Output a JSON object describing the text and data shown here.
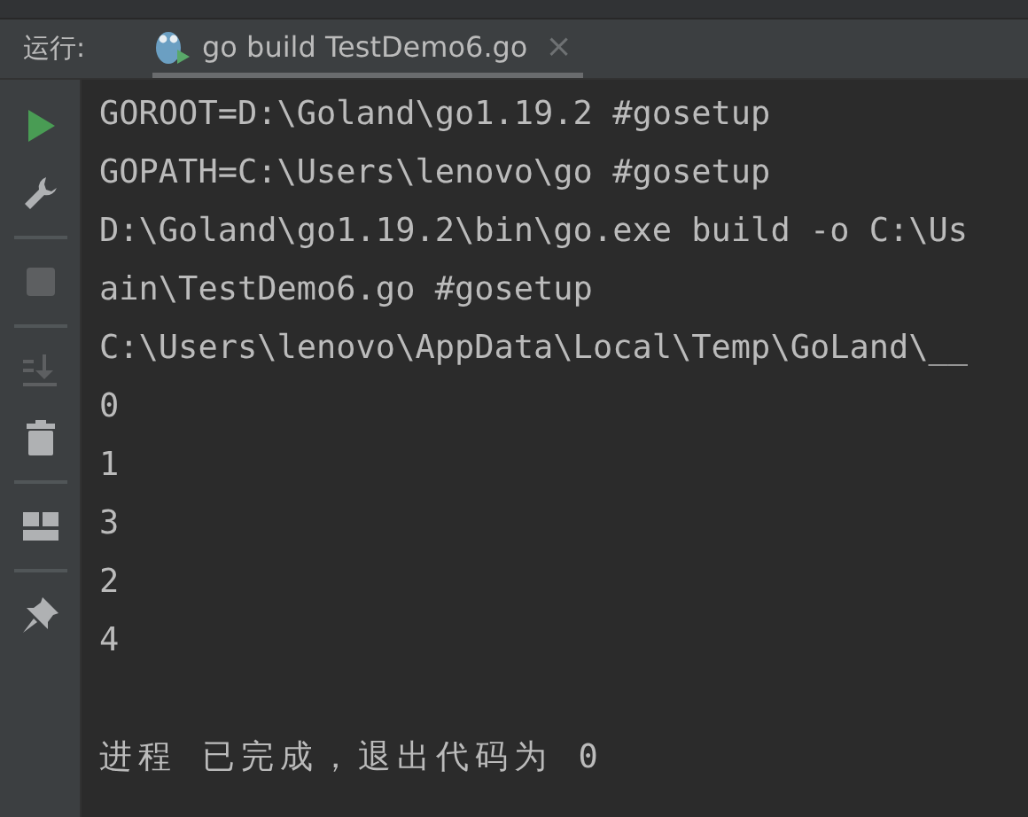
{
  "run_bar": {
    "label": "运行:",
    "tab": {
      "title": "go build TestDemo6.go",
      "close": "×",
      "selected": true
    }
  },
  "toolbar": [
    {
      "kind": "run",
      "disabled": false
    },
    {
      "kind": "settings",
      "disabled": false
    },
    {
      "kind": "divider"
    },
    {
      "kind": "stop",
      "disabled": true
    },
    {
      "kind": "divider"
    },
    {
      "kind": "scroll-end",
      "disabled": true
    },
    {
      "kind": "delete",
      "disabled": false
    },
    {
      "kind": "divider"
    },
    {
      "kind": "layout",
      "disabled": false
    },
    {
      "kind": "divider"
    },
    {
      "kind": "pin",
      "disabled": false
    }
  ],
  "console": {
    "lines": [
      {
        "kind": "output",
        "text": "GOROOT=D:\\Goland\\go1.19.2 #gosetup"
      },
      {
        "kind": "output",
        "text": "GOPATH=C:\\Users\\lenovo\\go #gosetup"
      },
      {
        "kind": "output",
        "text": "D:\\Goland\\go1.19.2\\bin\\go.exe build -o C:\\Us"
      },
      {
        "kind": "output",
        "text": "ain\\TestDemo6.go #gosetup"
      },
      {
        "kind": "output",
        "text": "C:\\Users\\lenovo\\AppData\\Local\\Temp\\GoLand\\__"
      },
      {
        "kind": "output",
        "text": "0"
      },
      {
        "kind": "output",
        "text": "1"
      },
      {
        "kind": "output",
        "text": "3"
      },
      {
        "kind": "output",
        "text": "2"
      },
      {
        "kind": "output",
        "text": "4"
      },
      {
        "kind": "exit",
        "text": "进程 已完成，退出代码为 0"
      }
    ]
  }
}
